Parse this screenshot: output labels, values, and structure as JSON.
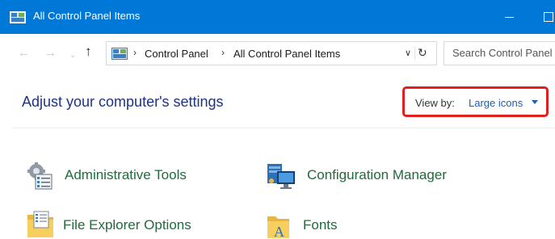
{
  "window": {
    "title": "All Control Panel Items",
    "accent_color": "#0078d7",
    "controls": {
      "minimize_icon": "minimize-icon",
      "maximize_icon": "maximize-icon"
    }
  },
  "nav": {
    "back_icon": "back-arrow-icon",
    "forward_icon": "forward-arrow-icon",
    "recent_icon": "chevron-down-icon",
    "up_icon": "up-arrow-icon"
  },
  "address": {
    "location_icon": "control-panel-icon",
    "breadcrumbs": [
      "Control Panel",
      "All Control Panel Items"
    ],
    "separator": "›",
    "dropdown_icon": "chevron-down-icon",
    "refresh_icon": "refresh-icon"
  },
  "search": {
    "placeholder": "Search Control Panel",
    "value": ""
  },
  "header": {
    "title": "Adjust your computer's settings",
    "view_by": {
      "label": "View by:",
      "value": "Large icons",
      "highlight_color": "#e01f1f"
    }
  },
  "items": [
    {
      "label": "Administrative Tools",
      "icon": "administrative-tools-icon"
    },
    {
      "label": "Configuration Manager",
      "icon": "configuration-manager-icon"
    },
    {
      "label": "File Explorer Options",
      "icon": "file-explorer-options-icon"
    },
    {
      "label": "Fonts",
      "icon": "fonts-icon"
    }
  ]
}
